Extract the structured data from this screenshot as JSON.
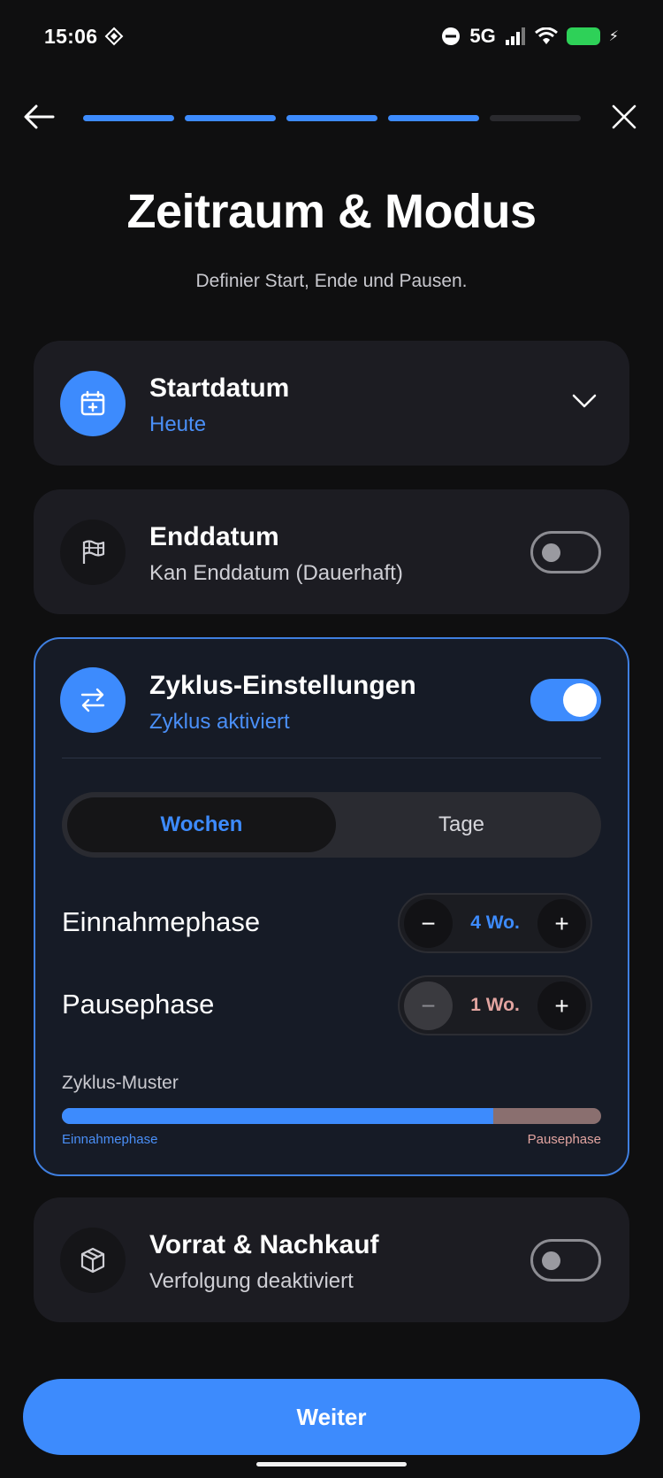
{
  "status": {
    "time": "15:06",
    "network": "5G"
  },
  "progress": {
    "total_steps": 5,
    "completed_steps": 4
  },
  "header": {
    "title": "Zeitraum & Modus",
    "subtitle": "Definier Start, Ende und Pausen."
  },
  "start": {
    "title": "Startdatum",
    "value": "Heute"
  },
  "end": {
    "title": "Enddatum",
    "value": "Kan Enddatum (Dauerhaft)",
    "enabled": false
  },
  "cycle": {
    "title": "Zyklus-Einstellungen",
    "status": "Zyklus aktiviert",
    "enabled": true,
    "unit_options": [
      "Wochen",
      "Tage"
    ],
    "selected_unit": "Wochen",
    "intake": {
      "label": "Einnahmephase",
      "value": "4 Wo."
    },
    "pause": {
      "label": "Pausephase",
      "value": "1 Wo."
    },
    "pattern": {
      "label": "Zyklus-Muster",
      "intake_caption": "Einnahmephase",
      "pause_caption": "Pausephase",
      "intake_fraction": 0.8
    }
  },
  "stock": {
    "title": "Vorrat & Nachkauf",
    "value": "Verfolgung deaktiviert",
    "enabled": false
  },
  "footer": {
    "next_label": "Weiter"
  },
  "colors": {
    "accent": "#3d8bfd",
    "pause": "#8a6f6f",
    "card": "#1c1c22",
    "background": "#0f0f10"
  }
}
